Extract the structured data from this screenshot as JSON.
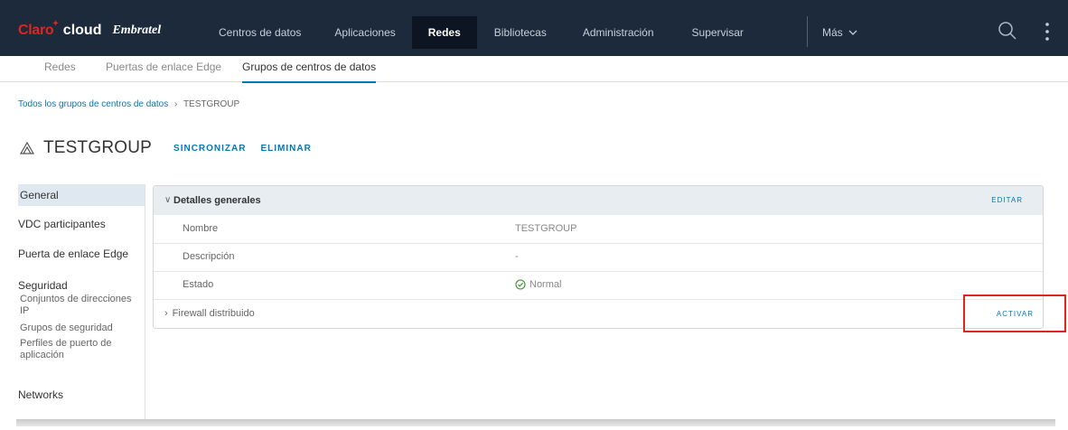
{
  "brand": {
    "claro": "Claro",
    "cloud": "cloud",
    "embratel": "Embratel"
  },
  "nav": {
    "items": [
      "Centros de datos",
      "Aplicaciones",
      "Redes",
      "Bibliotecas",
      "Administración",
      "Supervisar"
    ],
    "active": "Redes",
    "more_label": "Más"
  },
  "subtabs": [
    "Redes",
    "Puertas de enlace Edge",
    "Grupos de centros de datos"
  ],
  "breadcrumb": {
    "link": "Todos los grupos de centros de datos",
    "separator": "›",
    "current": "TESTGROUP"
  },
  "page": {
    "title": "TESTGROUP",
    "sync_label": "SINCRONIZAR",
    "delete_label": "ELIMINAR"
  },
  "leftnav": {
    "general": "General",
    "vdc": "VDC participantes",
    "edge": "Puerta de enlace Edge",
    "security": "Seguridad",
    "ipsets": "Conjuntos de direcciones IP",
    "secgroups": "Grupos de seguridad",
    "appprofiles": "Perfiles de puerto de aplicación",
    "networks": "Networks"
  },
  "details": {
    "header": "Detalles generales",
    "edit_label": "EDITAR",
    "rows": [
      {
        "key": "Nombre",
        "value": "TESTGROUP"
      },
      {
        "key": "Descripción",
        "value": "-"
      },
      {
        "key": "Estado",
        "value": "Normal"
      }
    ],
    "firewall_label": "Firewall distribuido",
    "activate_label": "ACTIVAR"
  },
  "colors": {
    "header_bg": "#1c2a3c",
    "accent": "#0079b8",
    "brand_red": "#e2241f",
    "status_ok": "#3c8d2f"
  }
}
